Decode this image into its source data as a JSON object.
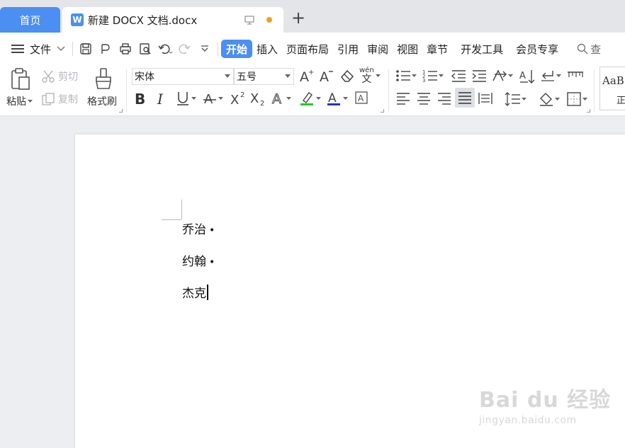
{
  "tabs": {
    "home": "首页",
    "doc_title": "新建 DOCX 文档.docx",
    "doc_icon": "W",
    "add": "+"
  },
  "menu": {
    "file": "文件",
    "items": [
      "开始",
      "插入",
      "页面布局",
      "引用",
      "审阅",
      "视图",
      "章节",
      "开发工具",
      "会员专享"
    ],
    "search": "查"
  },
  "ribbon": {
    "paste": "粘贴",
    "cut": "剪切",
    "copy": "复制",
    "format_painter": "格式刷",
    "font_name": "宋体",
    "font_size": "五号",
    "pinyin": "wén",
    "style_preview": "AaB",
    "style_label": "正"
  },
  "document": {
    "paragraphs": [
      "乔治",
      "约翰",
      "杰克"
    ],
    "paragraph_mark": "•"
  },
  "watermark": {
    "brand": "Bai du 经验",
    "url": "jingyan.baidu.com"
  },
  "colors": {
    "accent": "#4c8ff3",
    "highlight": "#22cc22",
    "font_color": "#2233cc",
    "unsaved_dot": "#f0a020"
  }
}
